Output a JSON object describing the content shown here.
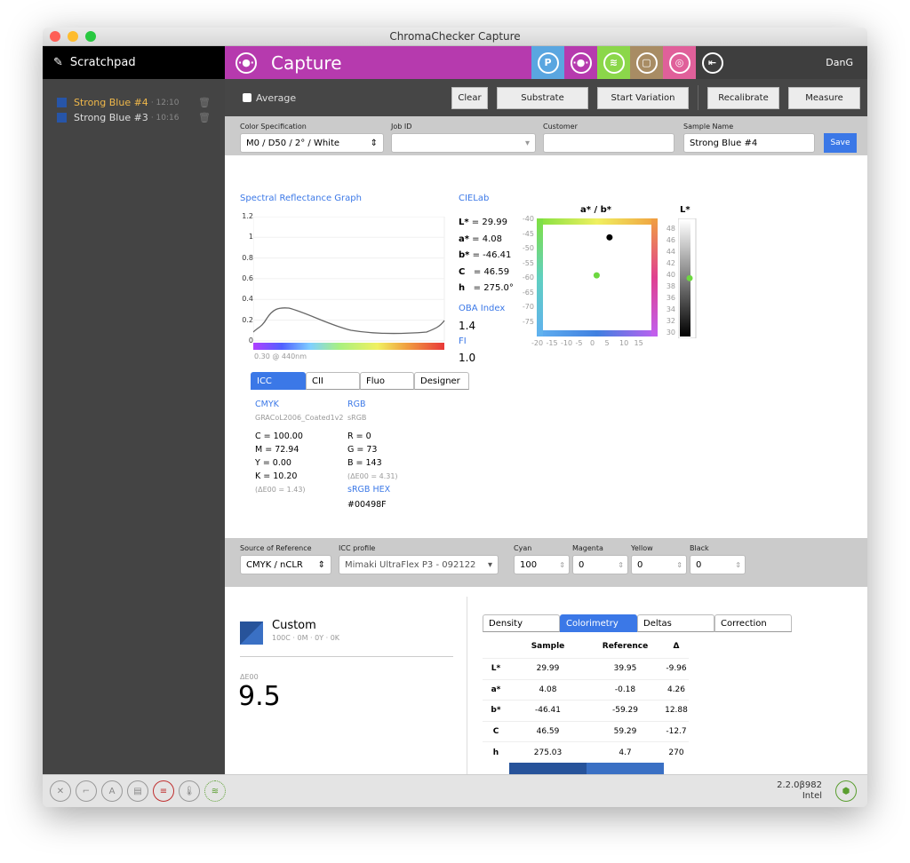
{
  "window": {
    "title": "ChromaChecker Capture"
  },
  "sidebar": {
    "title": "Scratchpad",
    "items": [
      {
        "name": "Strong Blue #4",
        "time": "· 12:10",
        "active": true
      },
      {
        "name": "Strong Blue #3",
        "time": "· 10:16",
        "active": false
      }
    ]
  },
  "header": {
    "title": "Capture",
    "user": "DanG",
    "icons": [
      "p-icon",
      "capture-icon",
      "substrate-icon",
      "document-icon",
      "target-icon",
      "logout-icon"
    ]
  },
  "toolbar": {
    "average": "Average",
    "clear": "Clear",
    "substrate": "Substrate",
    "start_variation": "Start Variation",
    "recalibrate": "Recalibrate",
    "measure": "Measure"
  },
  "form": {
    "color_spec_label": "Color Specification",
    "color_spec_value": "M0 / D50 / 2° / White",
    "job_id_label": "Job ID",
    "job_id_value": "",
    "customer_label": "Customer",
    "customer_value": "",
    "sample_name_label": "Sample Name",
    "sample_name_value": "Strong Blue #4",
    "save": "Save"
  },
  "spectral": {
    "title": "Spectral Reflectance Graph",
    "yticks": [
      "1.2",
      "1",
      "0.8",
      "0.6",
      "0.4",
      "0.2",
      "0"
    ],
    "readout": "0.30 @ 440nm"
  },
  "cielab": {
    "title": "CIELab",
    "L": "L*",
    "L_val": "= 29.99",
    "a": "a*",
    "a_val": "= 4.08",
    "b": "b*",
    "b_val": "= -46.41",
    "C": "C",
    "C_val": "= 46.59",
    "h": "h",
    "h_val": "= 275.0°",
    "oba_title": "OBA Index",
    "oba_val": "1.4",
    "fi_title": "FI",
    "fi_val": "1.0"
  },
  "abplot": {
    "title": "a* / b*",
    "yticks": [
      "-40",
      "-45",
      "-50",
      "-55",
      "-60",
      "-65",
      "-70",
      "-75"
    ],
    "xticks": [
      "-20",
      "-15",
      "-10",
      "-5",
      "0",
      "5",
      "10",
      "15"
    ],
    "sample": {
      "a": 4.08,
      "b": -46.41
    },
    "reference": {
      "a": -0.18,
      "b": -59.29
    }
  },
  "lplot": {
    "title": "L*",
    "ticks": [
      "48",
      "46",
      "44",
      "42",
      "40",
      "38",
      "36",
      "34",
      "32",
      "30"
    ],
    "reference": 39.95
  },
  "icc_tabs": [
    "ICC",
    "CII",
    "Fluo",
    "Designer"
  ],
  "icc": {
    "cmyk_title": "CMYK",
    "cmyk_profile": "GRACoL2006_Coated1v2",
    "C": "C = 100.00",
    "M": "M = 72.94",
    "Y": "Y = 0.00",
    "K": "K = 10.20",
    "cmyk_de": "(ΔE00 = 1.43)",
    "rgb_title": "RGB",
    "rgb_profile": "sRGB",
    "R": "R = 0",
    "G": "G = 73",
    "B": "B = 143",
    "rgb_de": "(ΔE00 = 4.31)",
    "hex_title": "sRGB HEX",
    "hex": "#00498F"
  },
  "reference": {
    "source_label": "Source of Reference",
    "source_value": "CMYK / nCLR",
    "icc_label": "ICC profile",
    "icc_value": "Mimaki UltraFlex P3 - 092122",
    "cyan_label": "Cyan",
    "cyan": "100",
    "magenta_label": "Magenta",
    "magenta": "0",
    "yellow_label": "Yellow",
    "yellow": "0",
    "black_label": "Black",
    "black": "0"
  },
  "result": {
    "name": "Custom",
    "sub": "100C · 0M · 0Y · 0K",
    "de_label": "ΔE00",
    "de": "9.5"
  },
  "result_tabs": [
    "Density",
    "Colorimetry",
    "Deltas",
    "Correction"
  ],
  "table": {
    "headers": [
      "",
      "Sample",
      "Reference",
      "Δ"
    ],
    "rows": [
      [
        "L*",
        "29.99",
        "39.95",
        "-9.96"
      ],
      [
        "a*",
        "4.08",
        "-0.18",
        "4.26"
      ],
      [
        "b*",
        "-46.41",
        "-59.29",
        "12.88"
      ],
      [
        "C",
        "46.59",
        "59.29",
        "-12.7"
      ],
      [
        "h",
        "275.03",
        "4.7",
        "270"
      ]
    ],
    "sample_color": "#27539a",
    "reference_color": "#3a70c4"
  },
  "footer": {
    "version": "2.2.0β982",
    "arch": "Intel"
  }
}
